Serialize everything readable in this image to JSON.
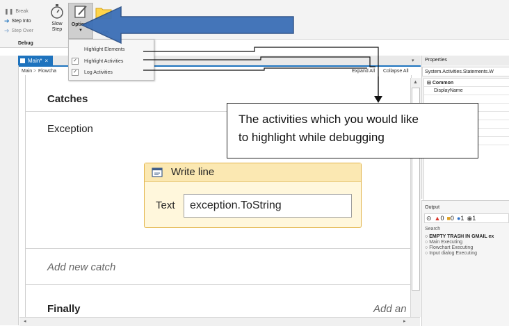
{
  "ribbon": {
    "break_label": "Break",
    "step_into_label": "Step Into",
    "step_over_label": "Step Over",
    "slow_step_label": "Slow\nStep",
    "options_label": "Options",
    "logs_label": "Logs",
    "group_label": "Debug"
  },
  "options_menu": {
    "items": [
      {
        "label": "Highlight Elements",
        "checked": false
      },
      {
        "label": "Highlight Activities",
        "checked": true
      },
      {
        "label": "Log Activities",
        "checked": true
      }
    ]
  },
  "document": {
    "tab_label": "Main*",
    "tab_close": "×",
    "breadcrumb_root": "Main",
    "breadcrumb_sep": ">",
    "breadcrumb_child": "Flowcha",
    "expand_all": "Expand All",
    "collapse_all": "Collapse All",
    "dropdown_arrow": "▾"
  },
  "designer": {
    "catches_title": "Catches",
    "exception_label": "Exception",
    "add_new_catch": "Add new catch",
    "finally_title": "Finally",
    "add_an": "Add an"
  },
  "write_line": {
    "title": "Write line",
    "field_label": "Text",
    "field_value": "exception.ToString"
  },
  "callout": {
    "line1": "The activities which you would like",
    "line2": "to highlight while debugging"
  },
  "properties": {
    "title": "Properties",
    "type_name": "System.Activities.Statements.W",
    "category": "Common",
    "rows": [
      "DisplayName"
    ]
  },
  "output": {
    "title": "Output",
    "badges": [
      "0",
      "0",
      "1",
      "1"
    ],
    "search_label": "Search",
    "lines": [
      "EMPTY TRASH IN GMAIL ex",
      "Main Executing",
      "Flowchart Executing",
      "Input dialog Executing"
    ]
  },
  "colors": {
    "accent_blue": "#1e73be",
    "arrow_blue": "#3b6fb6",
    "activity_border": "#e2b44a",
    "activity_header": "#fbe8b2"
  }
}
